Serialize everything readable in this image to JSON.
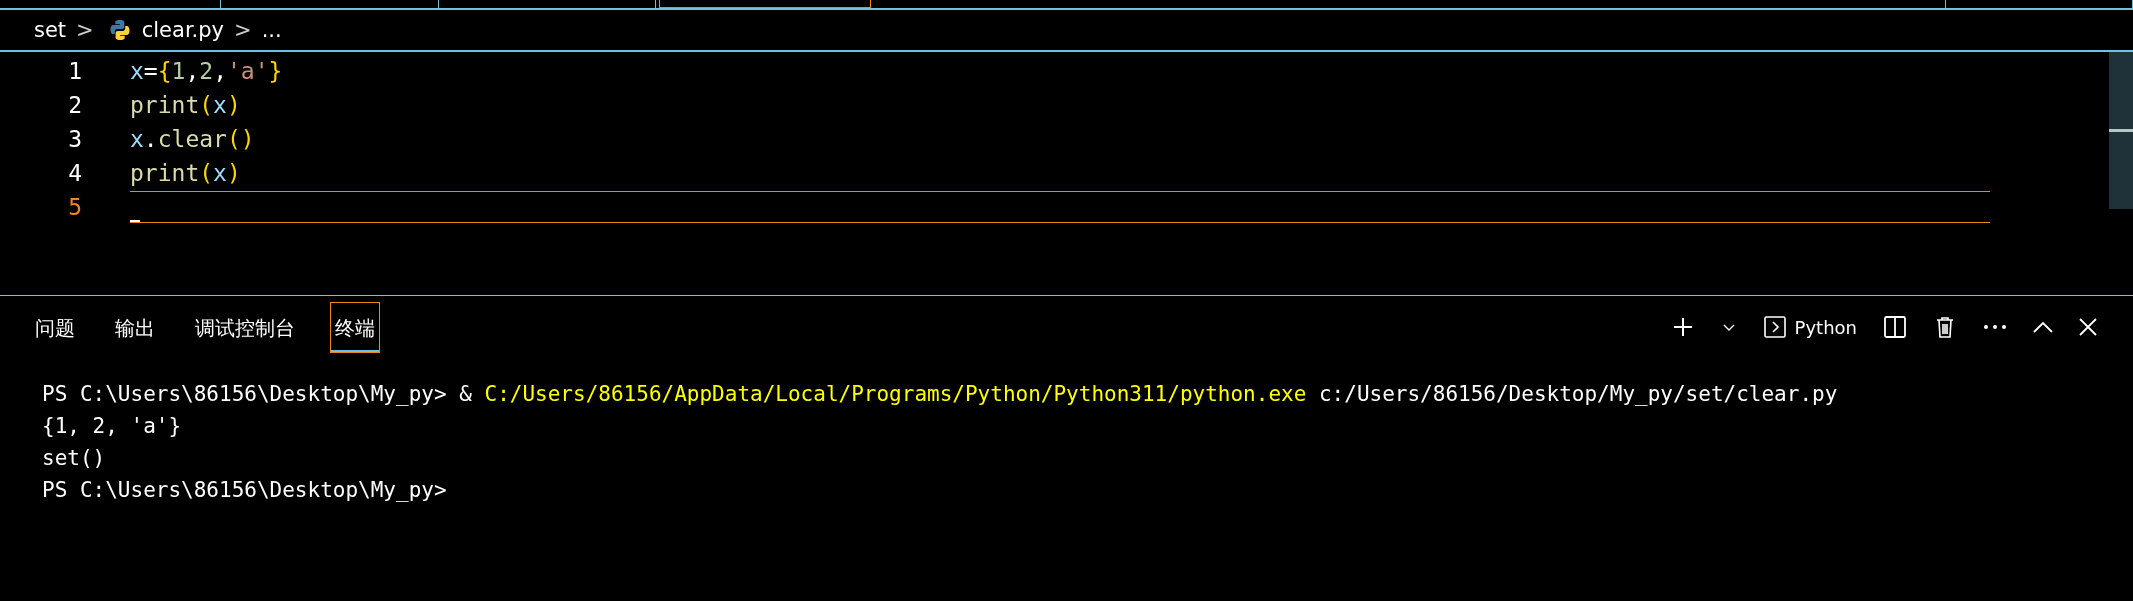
{
  "editor_tabs": [
    {
      "selected": false
    },
    {
      "selected": false
    },
    {
      "selected": false
    },
    {
      "selected": true
    },
    {
      "selected": false
    },
    {
      "selected": false
    }
  ],
  "breadcrumb": {
    "folder": "set",
    "separator_1": ">",
    "file": "clear.py",
    "separator_2": ">",
    "more": "..."
  },
  "editor": {
    "lines": [
      {
        "number": "1",
        "current": false,
        "tokens": [
          {
            "text": "x",
            "kind": "variable"
          },
          {
            "text": "=",
            "kind": "operator"
          },
          {
            "text": "{",
            "kind": "bracket"
          },
          {
            "text": "1",
            "kind": "number"
          },
          {
            "text": ",",
            "kind": "operator"
          },
          {
            "text": "2",
            "kind": "number"
          },
          {
            "text": ",",
            "kind": "operator"
          },
          {
            "text": "'a'",
            "kind": "string"
          },
          {
            "text": "}",
            "kind": "bracket"
          }
        ]
      },
      {
        "number": "2",
        "current": false,
        "tokens": [
          {
            "text": "print",
            "kind": "function"
          },
          {
            "text": "(",
            "kind": "bracket"
          },
          {
            "text": "x",
            "kind": "variable"
          },
          {
            "text": ")",
            "kind": "bracket"
          }
        ]
      },
      {
        "number": "3",
        "current": false,
        "tokens": [
          {
            "text": "x",
            "kind": "variable"
          },
          {
            "text": ".",
            "kind": "operator"
          },
          {
            "text": "clear",
            "kind": "function"
          },
          {
            "text": "()",
            "kind": "bracket"
          }
        ]
      },
      {
        "number": "4",
        "current": false,
        "tokens": [
          {
            "text": "print",
            "kind": "function"
          },
          {
            "text": "(",
            "kind": "bracket"
          },
          {
            "text": "x",
            "kind": "variable"
          },
          {
            "text": ")",
            "kind": "bracket"
          }
        ]
      },
      {
        "number": "5",
        "current": true
      }
    ]
  },
  "panel": {
    "tabs": [
      {
        "label": "问题",
        "selected": false
      },
      {
        "label": "输出",
        "selected": false
      },
      {
        "label": "调试控制台",
        "selected": false
      },
      {
        "label": "终端",
        "selected": true
      }
    ],
    "terminal_profile": "Python",
    "terminal_lines": [
      {
        "segments": [
          {
            "text": "PS C:\\Users\\86156\\Desktop\\My_py> & ",
            "kind": "plain"
          },
          {
            "text": "C:/Users/86156/AppData/Local/Programs/Python/Python311/python.exe",
            "kind": "path"
          },
          {
            "text": " c:/Users/86156/Desktop/My_py/set/clear.py",
            "kind": "plain"
          }
        ]
      },
      {
        "segments": [
          {
            "text": "{1, 2, 'a'}",
            "kind": "plain"
          }
        ]
      },
      {
        "segments": [
          {
            "text": "set()",
            "kind": "plain"
          }
        ]
      },
      {
        "segments": [
          {
            "text": "PS C:\\Users\\86156\\Desktop\\My_py>",
            "kind": "plain"
          }
        ]
      }
    ]
  }
}
